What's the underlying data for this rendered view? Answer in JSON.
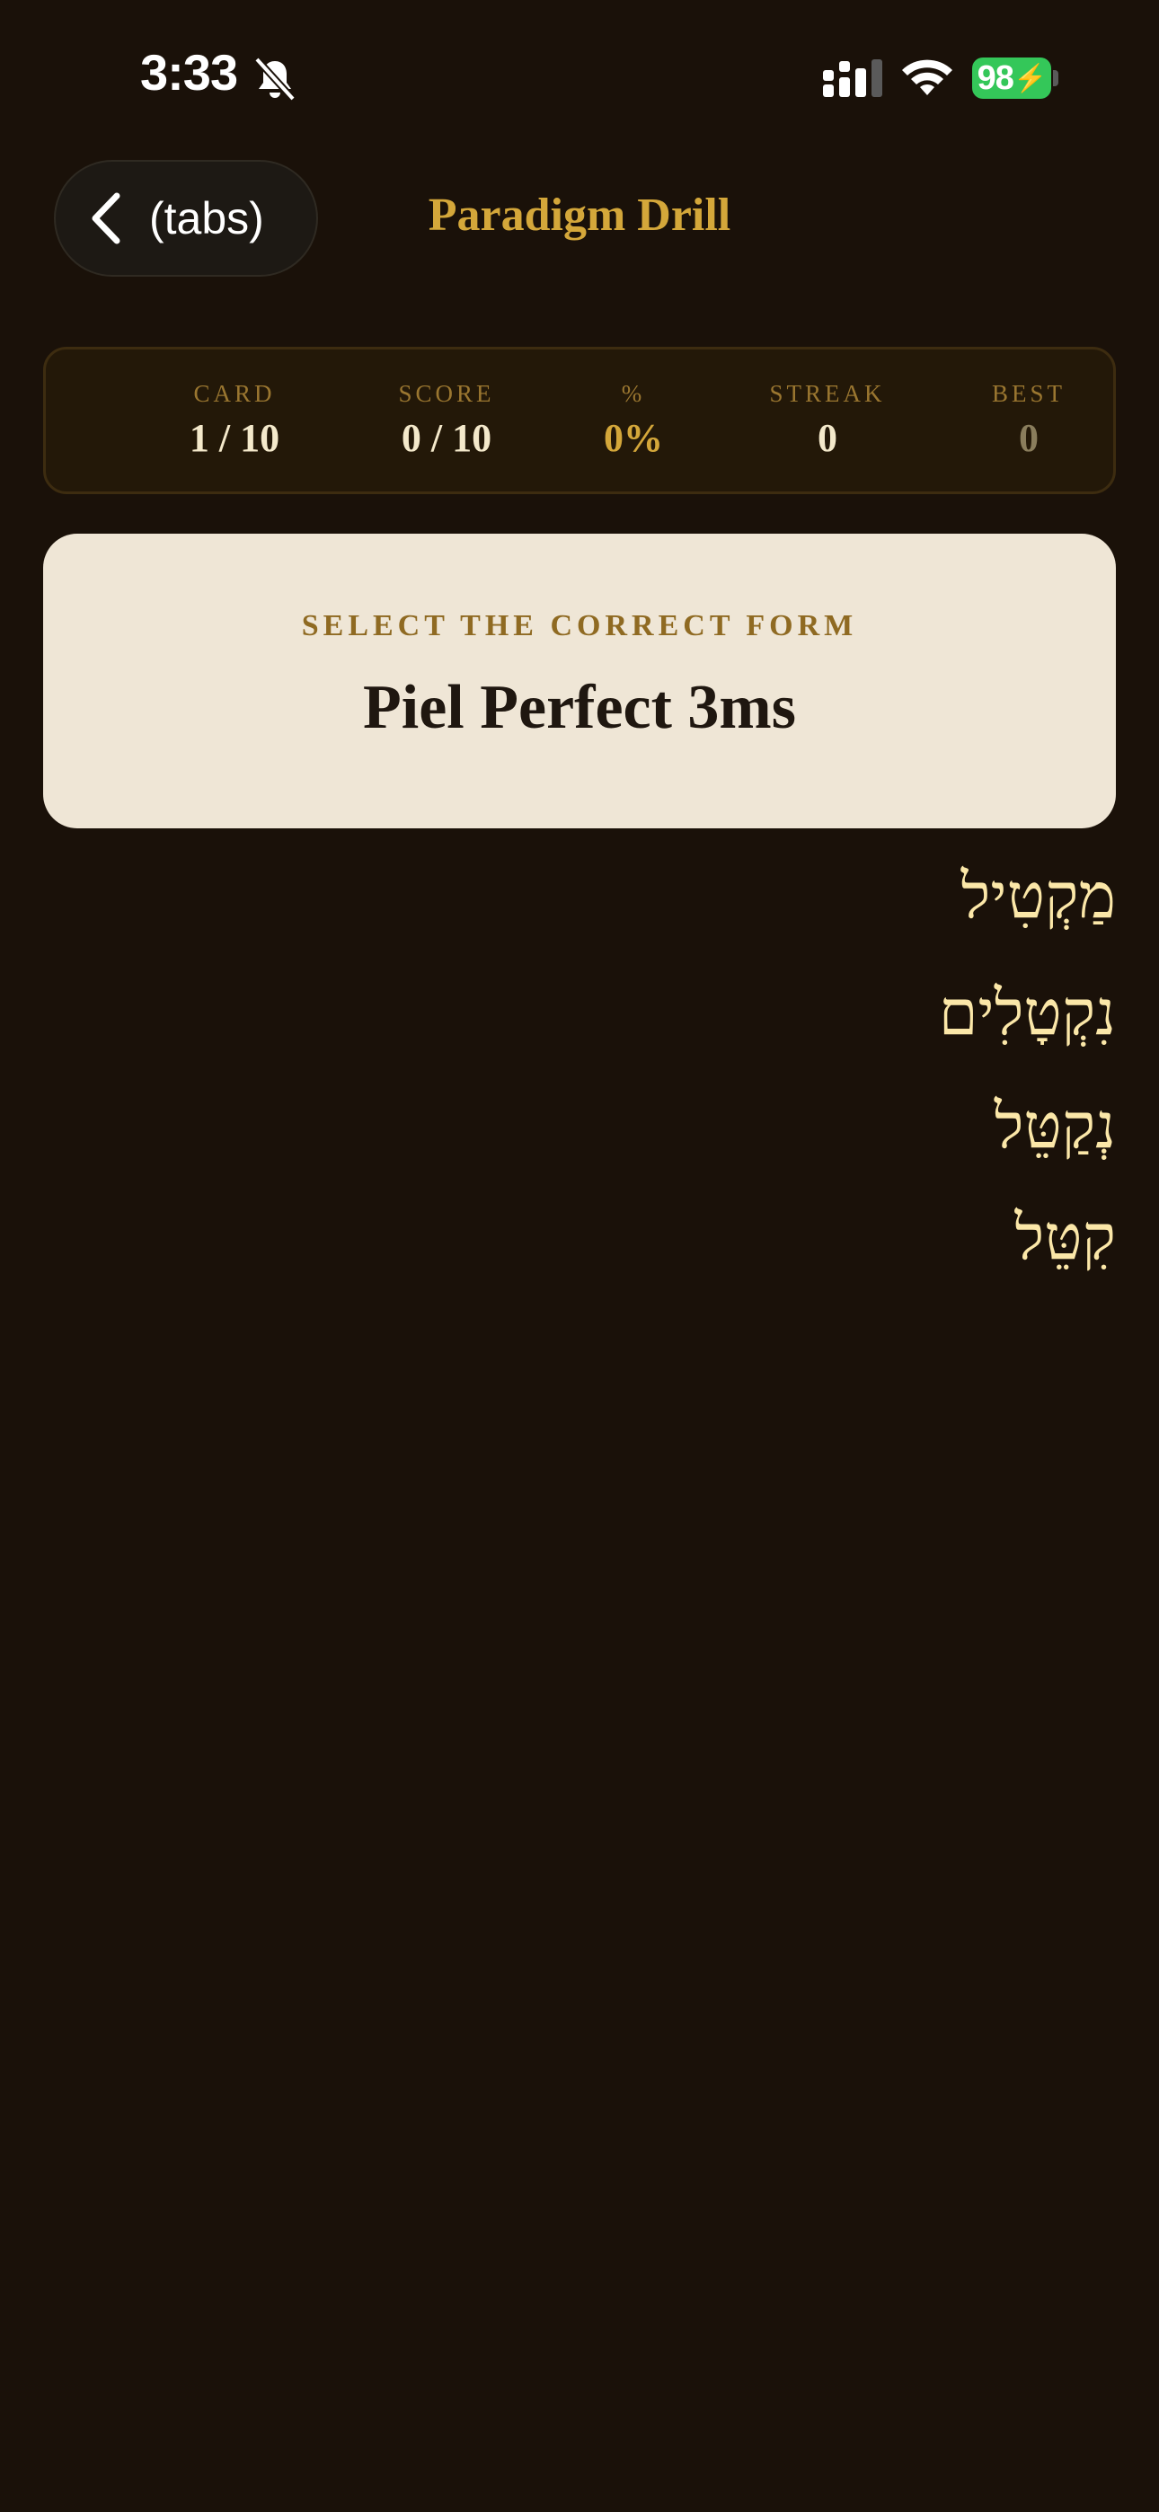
{
  "status_bar": {
    "time": "3:33",
    "battery": "98",
    "icons": [
      "bell-slash-icon",
      "cellular-signal-icon",
      "wifi-icon",
      "battery-charging-icon"
    ]
  },
  "header": {
    "back_label": "(tabs)",
    "title": "Paradigm Drill"
  },
  "stats": [
    {
      "label": "CARD",
      "value": "1 / 10"
    },
    {
      "label": "SCORE",
      "value": "0 / 10"
    },
    {
      "label": "%",
      "value": "0%"
    },
    {
      "label": "STREAK",
      "value": "0"
    },
    {
      "label": "BEST",
      "value": "0"
    }
  ],
  "prompt": {
    "label": "SELECT THE CORRECT FORM",
    "text": "Piel Perfect 3ms"
  },
  "options": [
    "מַקְטִיל",
    "נִקְטָלִים",
    "נְקַטֵּל",
    "קִטֵּל"
  ],
  "colors": {
    "background": "#1a1109",
    "accent_gold": "#d4a73a",
    "option_text": "#fbe7a8",
    "card_bg": "#efe6d6",
    "battery_green": "#34c759"
  }
}
